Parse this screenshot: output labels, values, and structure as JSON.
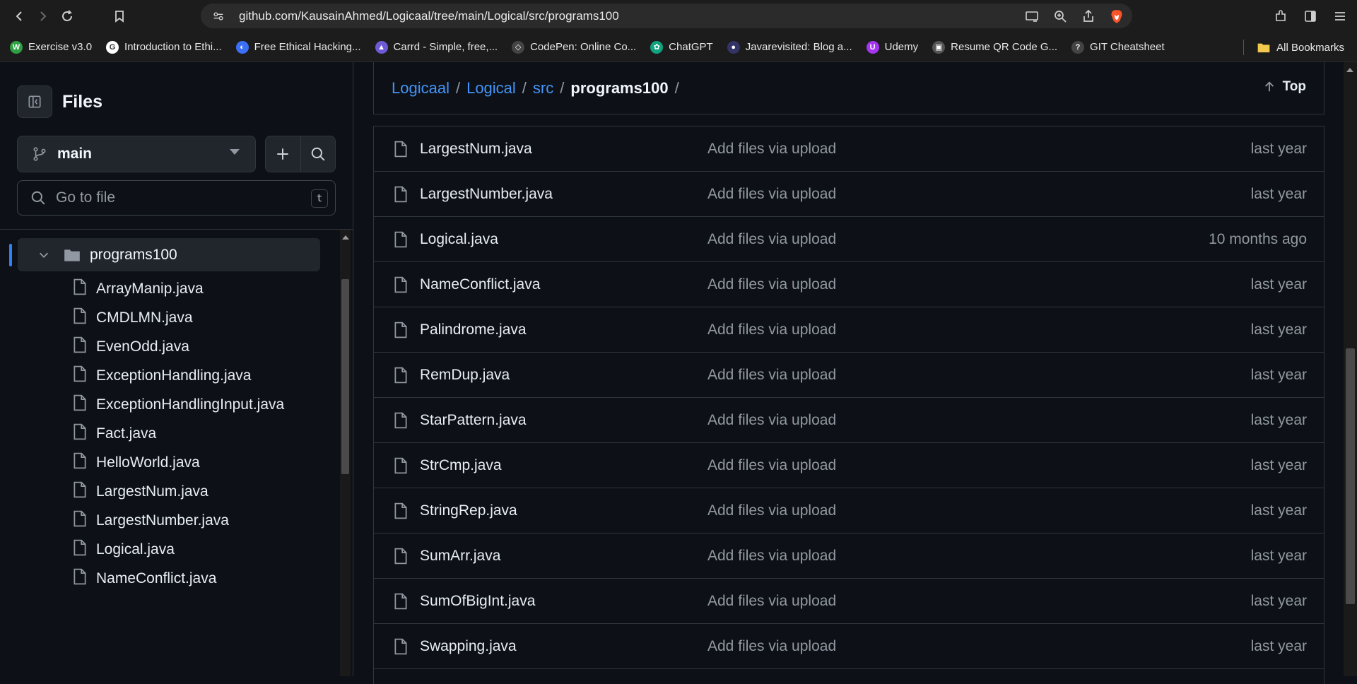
{
  "browser": {
    "url": "github.com/KausainAhmed/Logicaal/tree/main/Logical/src/programs100",
    "bookmarks": [
      {
        "label": "Exercise v3.0",
        "icon": "w-icon",
        "color": "#2ea043",
        "glyph": "W"
      },
      {
        "label": "Introduction to Ethi...",
        "icon": "google-icon",
        "color": "#ffffff",
        "glyph": "G"
      },
      {
        "label": "Free Ethical Hacking...",
        "icon": "globe-icon",
        "color": "#3b6ff5",
        "glyph": "◐"
      },
      {
        "label": "Carrd - Simple, free,...",
        "icon": "carrd-icon",
        "color": "#6e5ad6",
        "glyph": "▲"
      },
      {
        "label": "CodePen: Online Co...",
        "icon": "codepen-icon",
        "color": "#444444",
        "glyph": "◇"
      },
      {
        "label": "ChatGPT",
        "icon": "chatgpt-icon",
        "color": "#10a37f",
        "glyph": "✿"
      },
      {
        "label": "Javarevisited: Blog a...",
        "icon": "blog-icon",
        "color": "#333366",
        "glyph": "●"
      },
      {
        "label": "Udemy",
        "icon": "udemy-icon",
        "color": "#a435f0",
        "glyph": "U"
      },
      {
        "label": "Resume QR Code G...",
        "icon": "qr-icon",
        "color": "#555555",
        "glyph": "▣"
      },
      {
        "label": "GIT Cheatsheet",
        "icon": "git-icon",
        "color": "#444444",
        "glyph": "?"
      }
    ],
    "all_bookmarks": "All Bookmarks"
  },
  "sidebar": {
    "title": "Files",
    "branch": "main",
    "search_placeholder": "Go to file",
    "shortcut": "t",
    "current_folder": "programs100",
    "items": [
      "ArrayManip.java",
      "CMDLMN.java",
      "EvenOdd.java",
      "ExceptionHandling.java",
      "ExceptionHandlingInput.java",
      "Fact.java",
      "HelloWorld.java",
      "LargestNum.java",
      "LargestNumber.java",
      "Logical.java",
      "NameConflict.java"
    ]
  },
  "main": {
    "breadcrumb": [
      "Logicaal",
      "Logical",
      "src",
      "programs100"
    ],
    "top_label": "Top",
    "files": [
      {
        "name": "LargestNum.java",
        "commit": "Add files via upload",
        "age": "last year"
      },
      {
        "name": "LargestNumber.java",
        "commit": "Add files via upload",
        "age": "last year"
      },
      {
        "name": "Logical.java",
        "commit": "Add files via upload",
        "age": "10 months ago"
      },
      {
        "name": "NameConflict.java",
        "commit": "Add files via upload",
        "age": "last year"
      },
      {
        "name": "Palindrome.java",
        "commit": "Add files via upload",
        "age": "last year"
      },
      {
        "name": "RemDup.java",
        "commit": "Add files via upload",
        "age": "last year"
      },
      {
        "name": "StarPattern.java",
        "commit": "Add files via upload",
        "age": "last year"
      },
      {
        "name": "StrCmp.java",
        "commit": "Add files via upload",
        "age": "last year"
      },
      {
        "name": "StringRep.java",
        "commit": "Add files via upload",
        "age": "last year"
      },
      {
        "name": "SumArr.java",
        "commit": "Add files via upload",
        "age": "last year"
      },
      {
        "name": "SumOfBigInt.java",
        "commit": "Add files via upload",
        "age": "last year"
      },
      {
        "name": "Swapping.java",
        "commit": "Add files via upload",
        "age": "last year"
      }
    ]
  },
  "colors": {
    "accent": "#4493f8",
    "background": "#0d1117",
    "border": "#30363d"
  }
}
